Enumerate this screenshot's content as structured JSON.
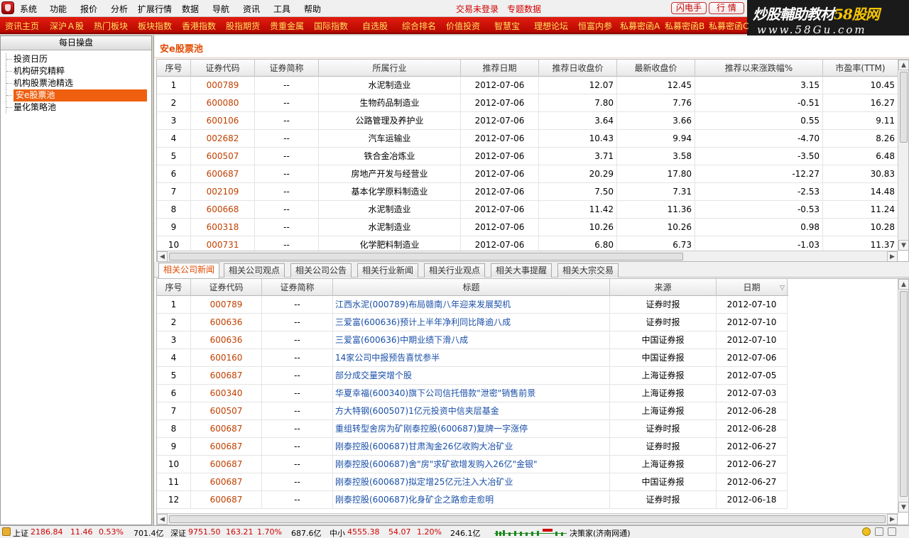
{
  "menubar": {
    "items": [
      "系统",
      "功能",
      "报价",
      "分析",
      "扩展行情",
      "数据",
      "导航",
      "资讯",
      "工具",
      "帮助"
    ],
    "status_login": "交易未登录",
    "status_topic": "专题数据",
    "btn_flash": "闪电手",
    "btn_quote": "行 情"
  },
  "brand": {
    "line1_a": "炒股輔助教材",
    "line1_b": "58股网",
    "line2": "www.58Gu.com"
  },
  "navbar": {
    "items": [
      "资讯主页",
      "深沪Ａ股",
      "热门板块",
      "板块指数",
      "香港指数",
      "股指期货",
      "贵重金属",
      "国际指数",
      "自选股",
      "综合排名",
      "价值投资",
      "智慧宝",
      "理想论坛",
      "恒富内参",
      "私募密函A",
      "私募密函B",
      "私募密函C"
    ]
  },
  "sidebar": {
    "title": "每日操盘",
    "items": [
      "投资日历",
      "机构研究精粹",
      "机构股票池精选",
      "安e股票池",
      "量化策略池"
    ]
  },
  "pane": {
    "title": "安e股票池"
  },
  "pool_table": {
    "headers": [
      "序号",
      "证券代码",
      "证券简称",
      "所属行业",
      "推荐日期",
      "推荐日收盘价",
      "最新收盘价",
      "推荐以来涨跌幅%",
      "市盈率(TTM)"
    ],
    "rows": [
      [
        "1",
        "000789",
        "--",
        "水泥制造业",
        "2012-07-06",
        "12.07",
        "12.45",
        "3.15",
        "10.45"
      ],
      [
        "2",
        "600080",
        "--",
        "生物药品制造业",
        "2012-07-06",
        "7.80",
        "7.76",
        "-0.51",
        "16.27"
      ],
      [
        "3",
        "600106",
        "--",
        "公路管理及养护业",
        "2012-07-06",
        "3.64",
        "3.66",
        "0.55",
        "9.11"
      ],
      [
        "4",
        "002682",
        "--",
        "汽车运输业",
        "2012-07-06",
        "10.43",
        "9.94",
        "-4.70",
        "8.26"
      ],
      [
        "5",
        "600507",
        "--",
        "铁合金冶炼业",
        "2012-07-06",
        "3.71",
        "3.58",
        "-3.50",
        "6.48"
      ],
      [
        "6",
        "600687",
        "--",
        "房地产开发与经营业",
        "2012-07-06",
        "20.29",
        "17.80",
        "-12.27",
        "30.83"
      ],
      [
        "7",
        "002109",
        "--",
        "基本化学原料制造业",
        "2012-07-06",
        "7.50",
        "7.31",
        "-2.53",
        "14.48"
      ],
      [
        "8",
        "600668",
        "--",
        "水泥制造业",
        "2012-07-06",
        "11.42",
        "11.36",
        "-0.53",
        "11.24"
      ],
      [
        "9",
        "600318",
        "--",
        "水泥制造业",
        "2012-07-06",
        "10.26",
        "10.26",
        "0.98",
        "10.28"
      ],
      [
        "10",
        "000731",
        "--",
        "化学肥料制造业",
        "2012-07-06",
        "6.80",
        "6.73",
        "-1.03",
        "11.37"
      ]
    ]
  },
  "tabs": [
    "相关公司新闻",
    "相关公司观点",
    "相关公司公告",
    "相关行业新闻",
    "相关行业观点",
    "相关大事提醒",
    "相关大宗交易"
  ],
  "news_table": {
    "headers": [
      "序号",
      "证券代码",
      "证券简称",
      "标题",
      "来源",
      "日期"
    ],
    "sort_indicator": "▽",
    "rows": [
      [
        "1",
        "000789",
        "--",
        "江西水泥(000789)布局赣南八年迎来发展契机",
        "证券时报",
        "2012-07-10"
      ],
      [
        "2",
        "600636",
        "--",
        "三爱富(600636)预计上半年净利同比降逾八成",
        "证券时报",
        "2012-07-10"
      ],
      [
        "3",
        "600636",
        "--",
        "三爱富(600636)中期业绩下滑八成",
        "中国证券报",
        "2012-07-10"
      ],
      [
        "4",
        "600160",
        "--",
        "14家公司中报预告喜忧参半",
        "中国证券报",
        "2012-07-06"
      ],
      [
        "5",
        "600687",
        "--",
        "部分成交量突增个股",
        "上海证券报",
        "2012-07-05"
      ],
      [
        "6",
        "600340",
        "--",
        "华夏幸福(600340)旗下公司信托借款\"泄密\"销售前景",
        "上海证券报",
        "2012-07-03"
      ],
      [
        "7",
        "600507",
        "--",
        "方大特钢(600507)1亿元投资中信夹层基金",
        "上海证券报",
        "2012-06-28"
      ],
      [
        "8",
        "600687",
        "--",
        "重组转型舍房为矿刚泰控股(600687)复牌一字涨停",
        "证券时报",
        "2012-06-28"
      ],
      [
        "9",
        "600687",
        "--",
        "刚泰控股(600687)甘肃淘金26亿收购大冶矿业",
        "证券时报",
        "2012-06-27"
      ],
      [
        "10",
        "600687",
        "--",
        "刚泰控股(600687)舍\"房\"求矿欲增发购入26亿\"金银\"",
        "上海证券报",
        "2012-06-27"
      ],
      [
        "11",
        "600687",
        "--",
        "刚泰控股(600687)拟定增25亿元注入大冶矿业",
        "中国证券报",
        "2012-06-27"
      ],
      [
        "12",
        "600687",
        "--",
        "刚泰控股(600687)化身矿企之路愈走愈明",
        "证券时报",
        "2012-06-18"
      ]
    ]
  },
  "statusbar": {
    "sh_label": "上证",
    "sh_value": "2186.84",
    "sh_change": "11.46",
    "sh_pct": "0.53%",
    "sh_amount": "701.4亿",
    "sz_label": "深证",
    "sz_value": "9751.50",
    "sz_change": "163.21",
    "sz_pct": "1.70%",
    "sz_amount": "687.6亿",
    "zx_label": "中小",
    "zx_value": "4555.38",
    "zx_change": "54.07",
    "zx_pct": "1.20%",
    "zx_amount": "246.1亿",
    "server": "决策家(济南网通)"
  },
  "colors": {
    "accent": "#e04a00",
    "nav_red": "#d01000",
    "nav_text": "#ffe060",
    "up_red": "#d00000",
    "link_blue": "#1a4fa8"
  }
}
